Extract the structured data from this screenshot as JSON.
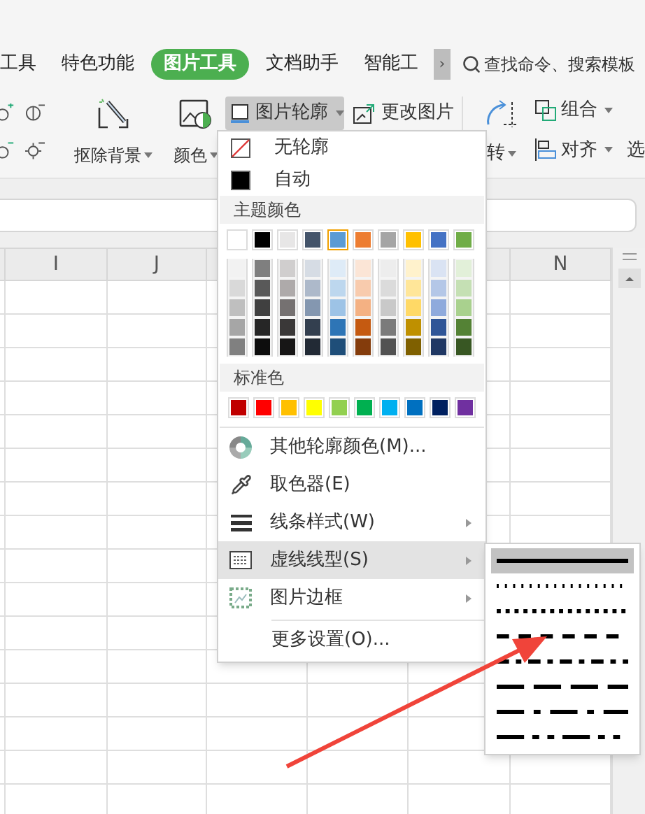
{
  "tabs": [
    {
      "label": "工具",
      "selected": false
    },
    {
      "label": "特色功能",
      "selected": false
    },
    {
      "label": "图片工具",
      "selected": true
    },
    {
      "label": "文档助手",
      "selected": false
    },
    {
      "label": "智能工",
      "selected": false
    }
  ],
  "tab_more": "›",
  "search": {
    "placeholder": "查找命令、搜索模板"
  },
  "ribbon": {
    "remove_background": "抠除背景",
    "color_label": "颜色",
    "outline": "图片轮廓",
    "outline_open": true,
    "change_picture": "更改图片",
    "rotate": "转",
    "group": "组合",
    "align": "对齐",
    "select": "选"
  },
  "sheet": {
    "headers": [
      "I",
      "J",
      "N"
    ]
  },
  "menu": {
    "top_items": [
      {
        "label": "无轮廓"
      },
      {
        "label": "自动"
      }
    ],
    "theme_header": "主题颜色",
    "theme_colors": [
      {
        "color": "#ffffff",
        "selected": false
      },
      {
        "color": "#000000",
        "selected": false
      },
      {
        "color": "#e7e6e6",
        "selected": false
      },
      {
        "color": "#44546a",
        "selected": false
      },
      {
        "color": "#5b9bd5",
        "selected": true
      },
      {
        "color": "#ed7d31",
        "selected": false
      },
      {
        "color": "#a5a5a5",
        "selected": false
      },
      {
        "color": "#ffc000",
        "selected": false
      },
      {
        "color": "#4472c4",
        "selected": false
      },
      {
        "color": "#70ad47",
        "selected": false
      }
    ],
    "tints": [
      {
        "swatches": [
          {
            "color": "#f2f2f2"
          },
          {
            "color": "#7f7f7f"
          },
          {
            "color": "#d0cece"
          },
          {
            "color": "#d6dce4"
          },
          {
            "color": "#deebf7"
          },
          {
            "color": "#fbe5d6"
          },
          {
            "color": "#ededed"
          },
          {
            "color": "#fff2cc"
          },
          {
            "color": "#dae3f3"
          },
          {
            "color": "#e2f0d9"
          }
        ]
      },
      {
        "swatches": [
          {
            "color": "#d9d9d9"
          },
          {
            "color": "#595959"
          },
          {
            "color": "#aeaaaa"
          },
          {
            "color": "#adb9ca"
          },
          {
            "color": "#bdd7ee"
          },
          {
            "color": "#f8cbad"
          },
          {
            "color": "#dbdbdb"
          },
          {
            "color": "#ffe699"
          },
          {
            "color": "#b4c7e7"
          },
          {
            "color": "#c5e0b4"
          }
        ]
      },
      {
        "swatches": [
          {
            "color": "#bfbfbf"
          },
          {
            "color": "#404040"
          },
          {
            "color": "#757171"
          },
          {
            "color": "#8497b0"
          },
          {
            "color": "#9dc3e6"
          },
          {
            "color": "#f4b183"
          },
          {
            "color": "#c9c9c9"
          },
          {
            "color": "#ffd966"
          },
          {
            "color": "#8faadc"
          },
          {
            "color": "#a9d18e"
          }
        ]
      },
      {
        "swatches": [
          {
            "color": "#a6a6a6"
          },
          {
            "color": "#262626"
          },
          {
            "color": "#3a3838"
          },
          {
            "color": "#333f4f"
          },
          {
            "color": "#2e75b6"
          },
          {
            "color": "#c55a11"
          },
          {
            "color": "#7b7b7b"
          },
          {
            "color": "#bf9000"
          },
          {
            "color": "#2f5597"
          },
          {
            "color": "#548235"
          }
        ]
      },
      {
        "swatches": [
          {
            "color": "#808080"
          },
          {
            "color": "#0d0d0d"
          },
          {
            "color": "#171616"
          },
          {
            "color": "#222a35"
          },
          {
            "color": "#1f4e79"
          },
          {
            "color": "#843c0c"
          },
          {
            "color": "#525252"
          },
          {
            "color": "#7f6000"
          },
          {
            "color": "#203864"
          },
          {
            "color": "#385723"
          }
        ]
      }
    ],
    "standard_header": "标准色",
    "standard_colors": [
      {
        "color": "#c00000"
      },
      {
        "color": "#ff0000"
      },
      {
        "color": "#ffc000"
      },
      {
        "color": "#ffff00"
      },
      {
        "color": "#92d050"
      },
      {
        "color": "#00b050"
      },
      {
        "color": "#00b0f0"
      },
      {
        "color": "#0070c0"
      },
      {
        "color": "#002060"
      },
      {
        "color": "#7030a0"
      }
    ],
    "items": [
      {
        "label": "其他轮廓颜色(M)...",
        "kind": "action",
        "selected": false
      },
      {
        "label": "取色器(E)",
        "kind": "action",
        "selected": false
      },
      {
        "label": "线条样式(W)",
        "kind": "submenu",
        "selected": false
      },
      {
        "label": "虚线线型(S)",
        "kind": "submenu",
        "selected": true
      },
      {
        "label": "图片边框",
        "kind": "submenu",
        "selected": false
      }
    ],
    "more": "更多设置(O)..."
  },
  "dash_styles": [
    {
      "kind": "solid",
      "selected": true
    },
    {
      "kind": "round-dot",
      "selected": false
    },
    {
      "kind": "square-dot",
      "selected": false
    },
    {
      "kind": "dash",
      "selected": false
    },
    {
      "kind": "dash-dot",
      "selected": false
    },
    {
      "kind": "long-dash",
      "selected": false
    },
    {
      "kind": "long-dash-dot",
      "selected": false
    },
    {
      "kind": "long-dash-dot-dot",
      "selected": false
    }
  ]
}
